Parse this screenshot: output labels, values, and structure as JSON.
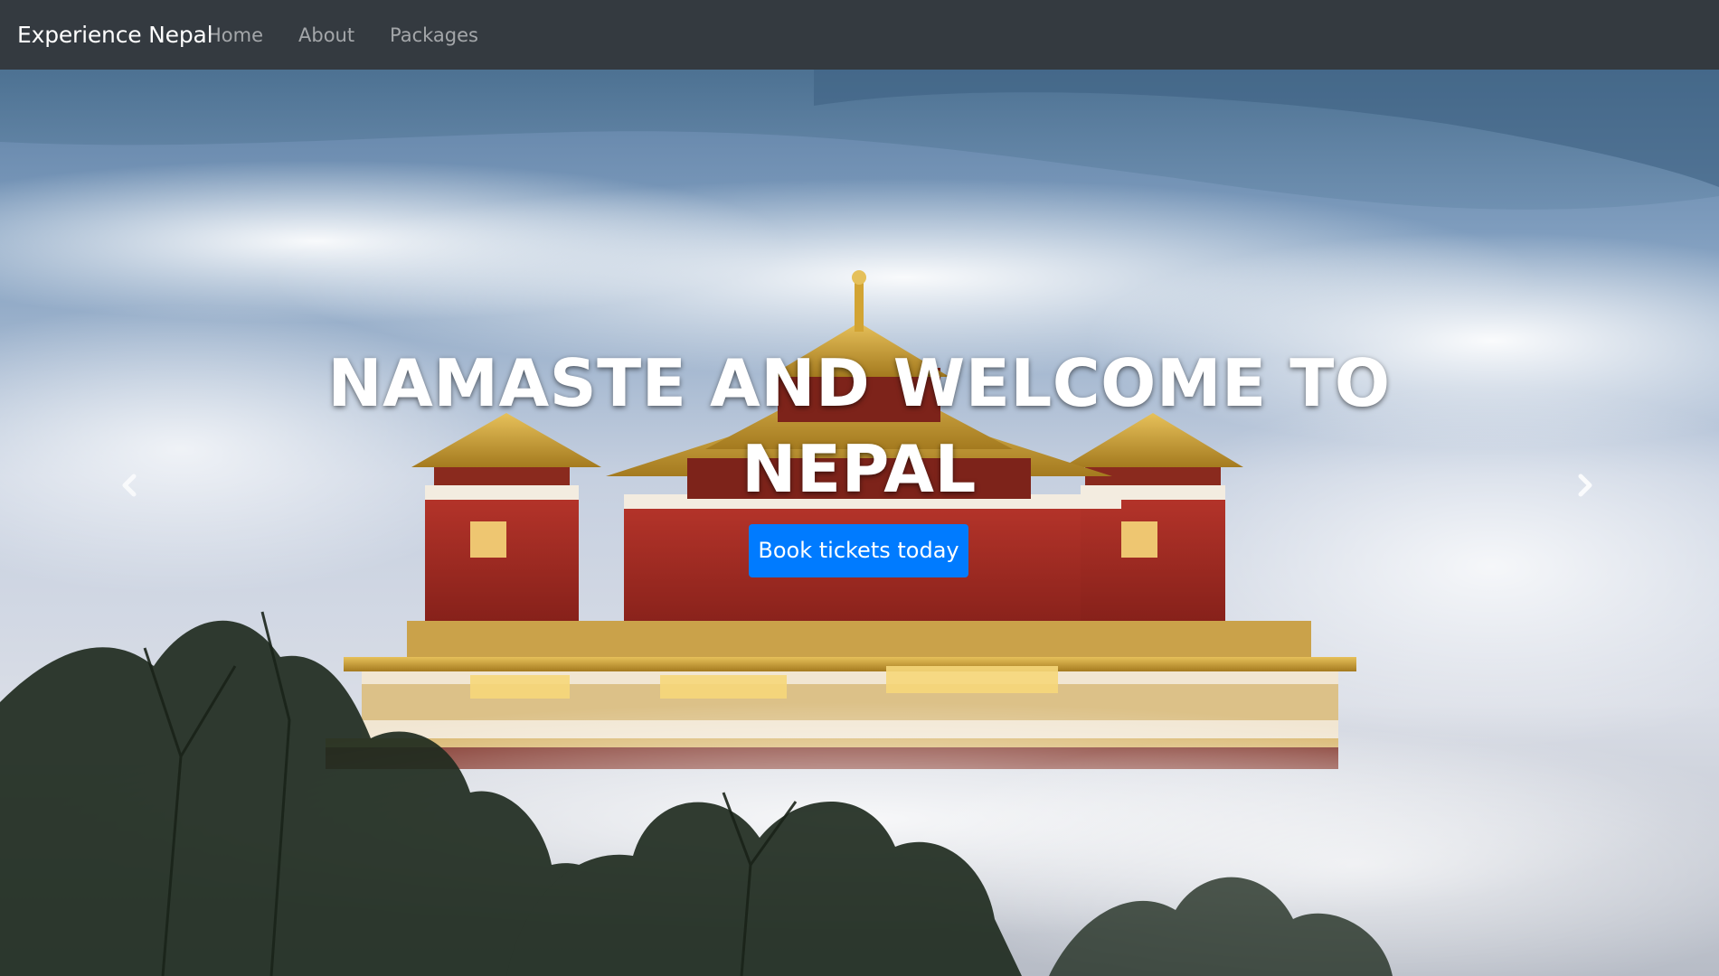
{
  "navbar": {
    "brand": "Experience Nepal",
    "links": [
      {
        "label": "Home"
      },
      {
        "label": "About"
      },
      {
        "label": "Packages"
      }
    ]
  },
  "hero": {
    "headline": "NAMASTE AND WELCOME TO NEPAL",
    "cta_label": "Book tickets today",
    "prev_icon": "chevron-left-icon",
    "next_icon": "chevron-right-icon"
  },
  "colors": {
    "navbar_bg": "#343a40",
    "accent": "#007bff",
    "text_light": "#ffffff"
  }
}
